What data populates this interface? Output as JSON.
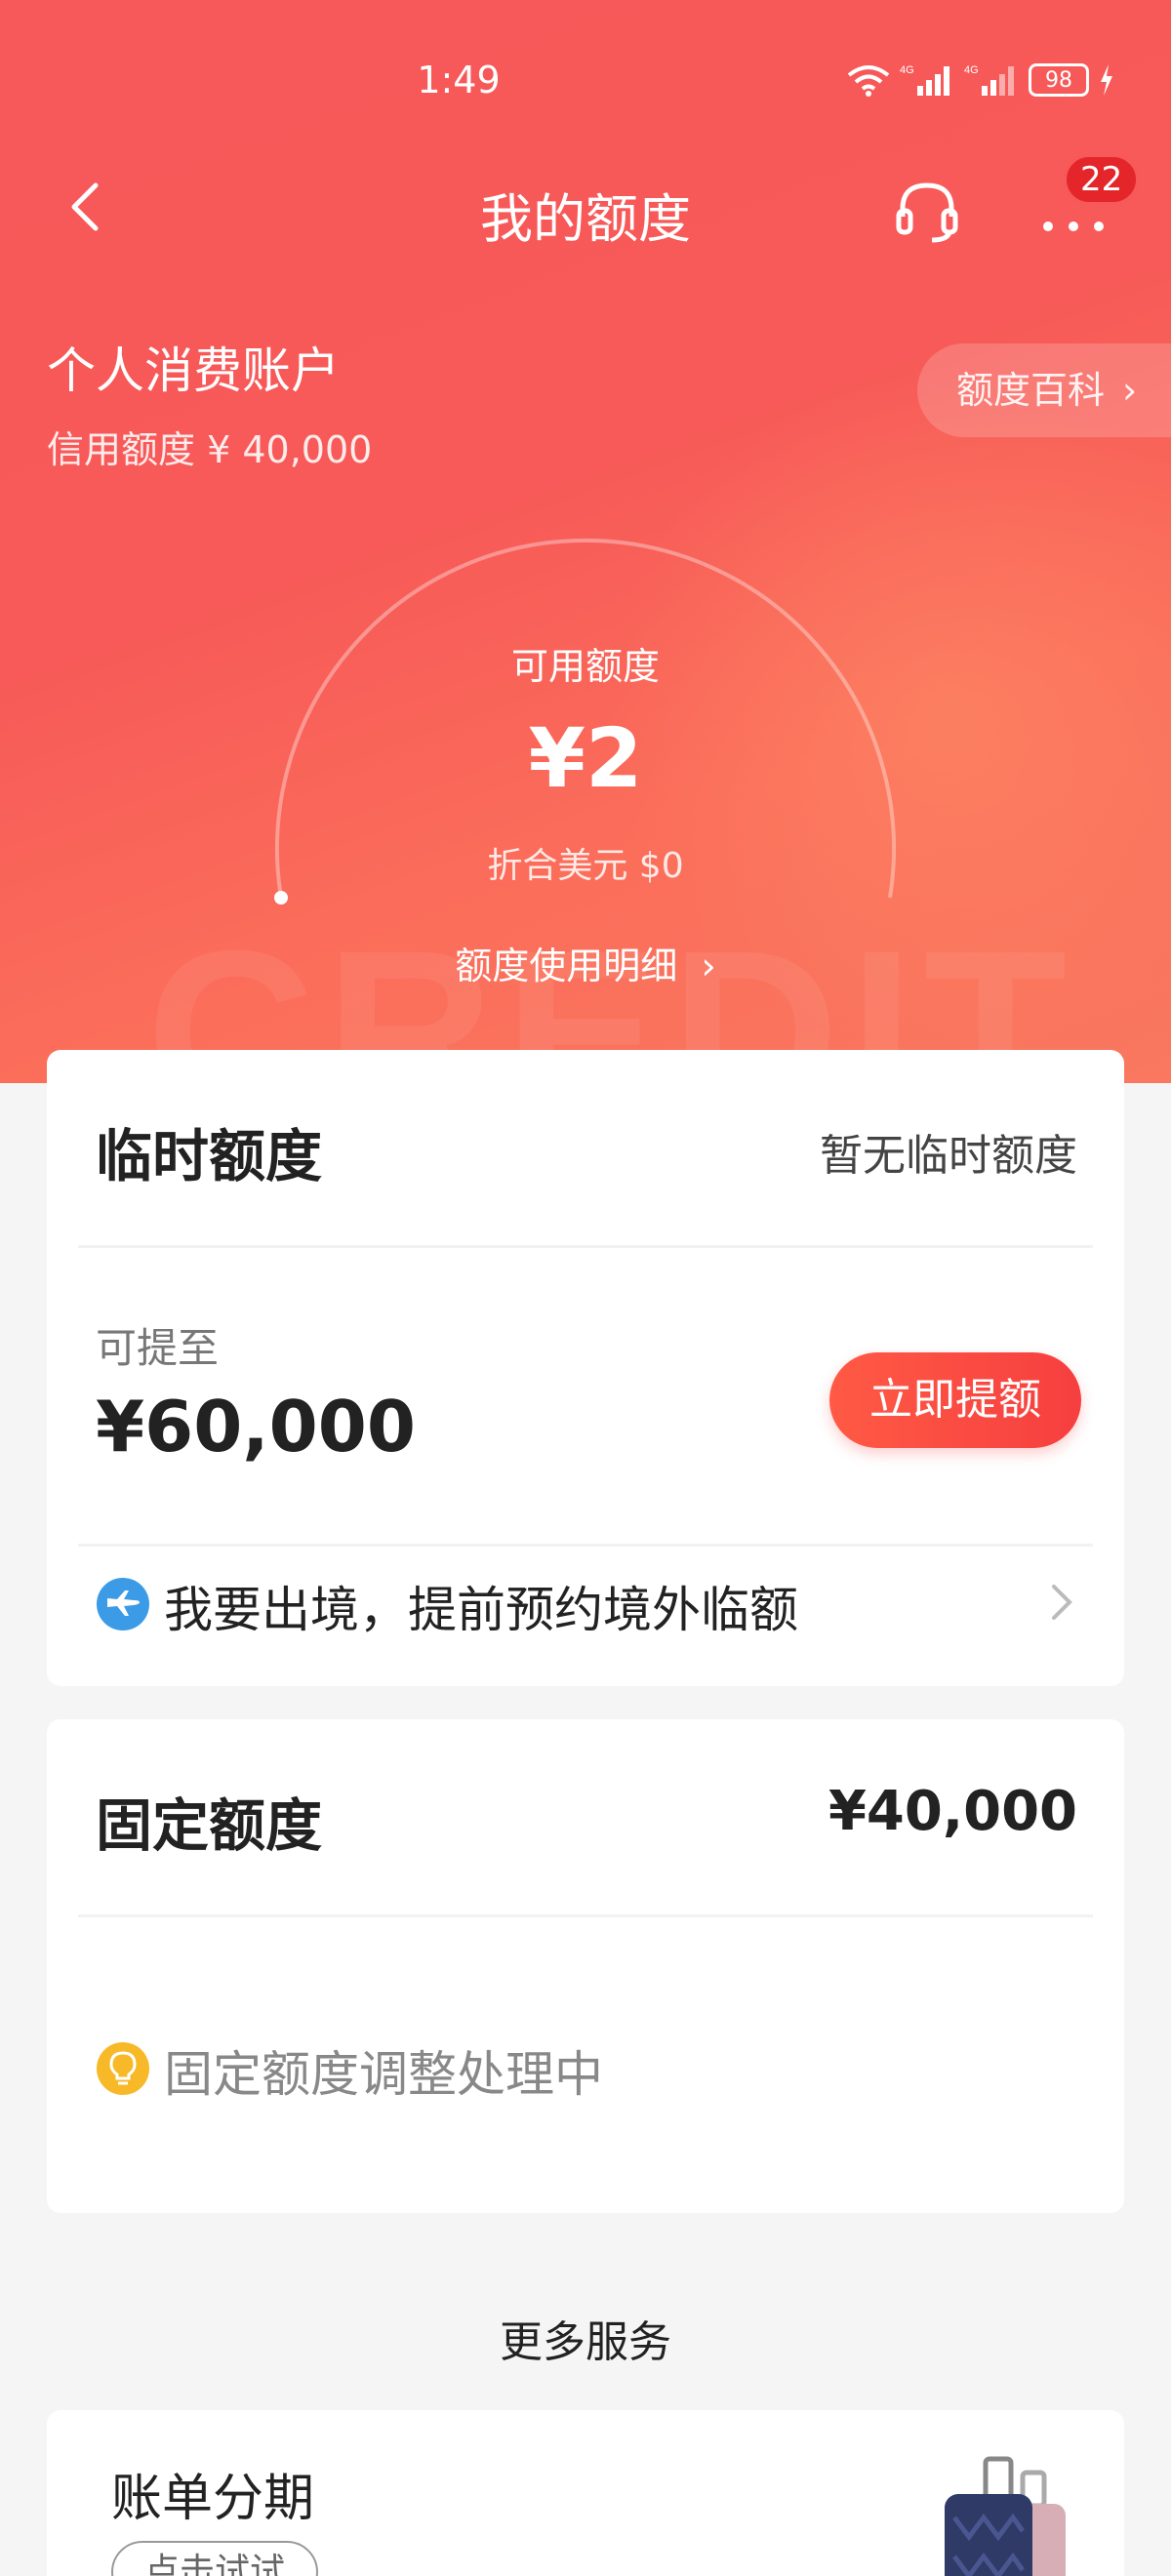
{
  "status_bar": {
    "time": "1:49",
    "battery": "98",
    "network1": "4G",
    "network2": "4G"
  },
  "nav": {
    "title": "我的额度",
    "badge_count": "22"
  },
  "account": {
    "title": "个人消费账户",
    "credit_limit": "信用额度 ¥ 40,000",
    "wiki_button": "额度百科",
    "available_label": "可用额度",
    "available_value": "¥2",
    "usd_value": "折合美元 $0",
    "usage_link": "额度使用明细",
    "watermark": "CREDIT",
    "gauge_fraction": 5e-05
  },
  "temp_limit": {
    "title": "临时额度",
    "status": "暂无临时额度",
    "can_raise_label": "可提至",
    "can_raise_value": "¥60,000",
    "raise_button": "立即提额",
    "abroad_text": "我要出境，提前预约境外临额"
  },
  "fixed_limit": {
    "title": "固定额度",
    "value": "¥40,000",
    "status_text": "固定额度调整处理中"
  },
  "more_services": {
    "title": "更多服务",
    "installment_title": "账单分期",
    "try_button": "点击试试"
  },
  "colors": {
    "brand_red": "#f7585a",
    "button_red": "#f63f3f"
  }
}
